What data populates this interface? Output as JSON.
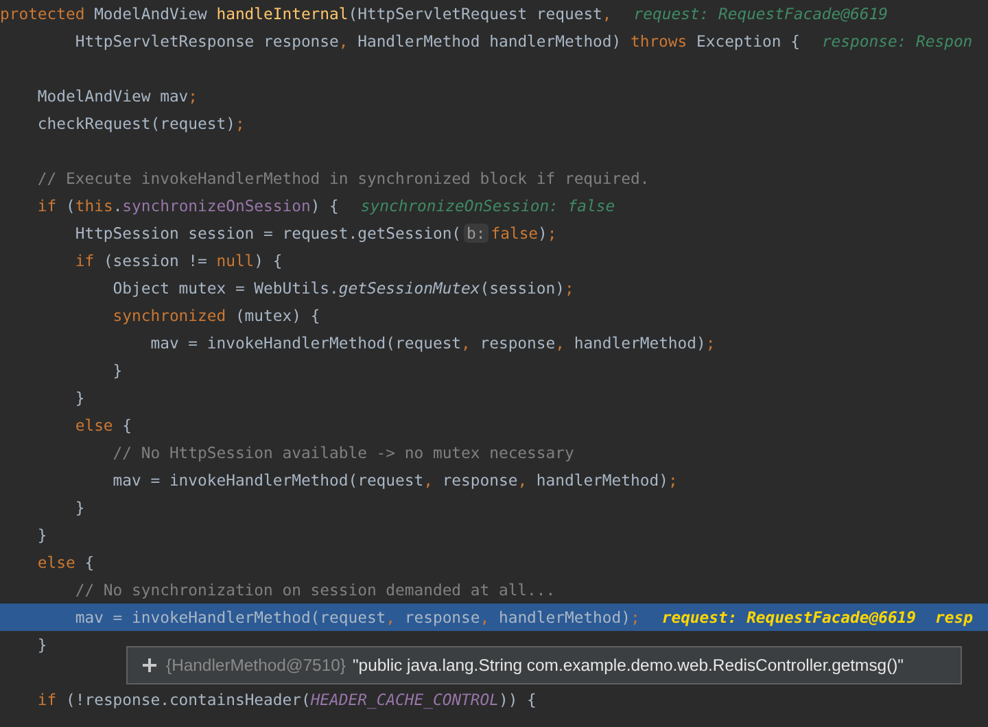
{
  "editor": {
    "lines": [
      {
        "selected": false,
        "code": [
          {
            "kind": "kw",
            "text": "protected "
          },
          {
            "kind": "plain",
            "text": "ModelAndView "
          },
          {
            "kind": "fn",
            "text": "handleInternal"
          },
          {
            "kind": "plain",
            "text": "(HttpServletRequest request"
          },
          {
            "kind": "punct",
            "text": ","
          }
        ],
        "hints": [
          "request: RequestFacade@6619"
        ]
      },
      {
        "selected": false,
        "code": [
          {
            "kind": "plain",
            "text": "        HttpServletResponse response"
          },
          {
            "kind": "punct",
            "text": ", "
          },
          {
            "kind": "plain",
            "text": "HandlerMethod handlerMethod) "
          },
          {
            "kind": "kw",
            "text": "throws "
          },
          {
            "kind": "plain",
            "text": "Exception {"
          }
        ],
        "hints": [
          "response: Respon"
        ]
      },
      {
        "selected": false
      },
      {
        "selected": false,
        "code": [
          {
            "kind": "plain",
            "text": "    ModelAndView mav"
          },
          {
            "kind": "punct",
            "text": ";"
          }
        ]
      },
      {
        "selected": false,
        "code": [
          {
            "kind": "plain",
            "text": "    checkRequest(request)"
          },
          {
            "kind": "punct",
            "text": ";"
          }
        ]
      },
      {
        "selected": false
      },
      {
        "selected": false,
        "code": [
          {
            "kind": "comment",
            "text": "    // Execute invokeHandlerMethod in synchronized block if required."
          }
        ]
      },
      {
        "selected": false,
        "code": [
          {
            "kind": "kw",
            "text": "    if "
          },
          {
            "kind": "plain",
            "text": "("
          },
          {
            "kind": "kw",
            "text": "this"
          },
          {
            "kind": "plain",
            "text": "."
          },
          {
            "kind": "field",
            "text": "synchronizeOnSession"
          },
          {
            "kind": "plain",
            "text": ") {"
          }
        ],
        "hints": [
          "synchronizeOnSession: false"
        ]
      },
      {
        "selected": false,
        "code": [
          {
            "kind": "plain",
            "text": "        HttpSession session = request.getSession("
          },
          {
            "kind": "param",
            "text": "b:"
          },
          {
            "kind": "kw",
            "text": "false"
          },
          {
            "kind": "plain",
            "text": ")"
          },
          {
            "kind": "punct",
            "text": ";"
          }
        ]
      },
      {
        "selected": false,
        "code": [
          {
            "kind": "kw",
            "text": "        if "
          },
          {
            "kind": "plain",
            "text": "(session != "
          },
          {
            "kind": "kw",
            "text": "null"
          },
          {
            "kind": "plain",
            "text": ") {"
          }
        ]
      },
      {
        "selected": false,
        "code": [
          {
            "kind": "plain",
            "text": "            Object mutex = WebUtils."
          },
          {
            "kind": "static",
            "text": "getSessionMutex"
          },
          {
            "kind": "plain",
            "text": "(session)"
          },
          {
            "kind": "punct",
            "text": ";"
          }
        ]
      },
      {
        "selected": false,
        "code": [
          {
            "kind": "kw",
            "text": "            synchronized "
          },
          {
            "kind": "plain",
            "text": "(mutex) {"
          }
        ]
      },
      {
        "selected": false,
        "code": [
          {
            "kind": "plain",
            "text": "                mav = invokeHandlerMethod(request"
          },
          {
            "kind": "punct",
            "text": ", "
          },
          {
            "kind": "plain",
            "text": "response"
          },
          {
            "kind": "punct",
            "text": ", "
          },
          {
            "kind": "plain",
            "text": "handlerMethod)"
          },
          {
            "kind": "punct",
            "text": ";"
          }
        ]
      },
      {
        "selected": false,
        "code": [
          {
            "kind": "plain",
            "text": "            }"
          }
        ]
      },
      {
        "selected": false,
        "code": [
          {
            "kind": "plain",
            "text": "        }"
          }
        ]
      },
      {
        "selected": false,
        "code": [
          {
            "kind": "kw",
            "text": "        else "
          },
          {
            "kind": "plain",
            "text": "{"
          }
        ]
      },
      {
        "selected": false,
        "code": [
          {
            "kind": "comment",
            "text": "            // No HttpSession available -> no mutex necessary"
          }
        ]
      },
      {
        "selected": false,
        "code": [
          {
            "kind": "plain",
            "text": "            mav = invokeHandlerMethod(request"
          },
          {
            "kind": "punct",
            "text": ", "
          },
          {
            "kind": "plain",
            "text": "response"
          },
          {
            "kind": "punct",
            "text": ", "
          },
          {
            "kind": "plain",
            "text": "handlerMethod)"
          },
          {
            "kind": "punct",
            "text": ";"
          }
        ]
      },
      {
        "selected": false,
        "code": [
          {
            "kind": "plain",
            "text": "        }"
          }
        ]
      },
      {
        "selected": false,
        "code": [
          {
            "kind": "plain",
            "text": "    }"
          }
        ]
      },
      {
        "selected": false,
        "code": [
          {
            "kind": "kw",
            "text": "    else "
          },
          {
            "kind": "plain",
            "text": "{"
          }
        ]
      },
      {
        "selected": false,
        "code": [
          {
            "kind": "comment",
            "text": "        // No synchronization on session demanded at all..."
          }
        ]
      },
      {
        "selected": true,
        "code": [
          {
            "kind": "plain",
            "text": "        mav = invokeHandlerMethod(request"
          },
          {
            "kind": "punct",
            "text": ", "
          },
          {
            "kind": "plain",
            "text": "response"
          },
          {
            "kind": "punct",
            "text": ", "
          },
          {
            "kind": "plain",
            "text": "handlerMethod)"
          },
          {
            "kind": "punct",
            "text": ";"
          }
        ],
        "hints": [
          "request: RequestFacade@6619",
          "resp"
        ]
      },
      {
        "selected": false,
        "code": [
          {
            "kind": "plain",
            "text": "    }"
          }
        ]
      },
      {
        "selected": false
      },
      {
        "selected": false,
        "code": [
          {
            "kind": "kw",
            "text": "    if "
          },
          {
            "kind": "plain",
            "text": "(!response.containsHeader("
          },
          {
            "kind": "const",
            "text": "HEADER_CACHE_CONTROL"
          },
          {
            "kind": "plain",
            "text": ")) {"
          }
        ]
      }
    ]
  },
  "tooltip": {
    "object_id": "{HandlerMethod@7510}",
    "value": "\"public java.lang.String com.example.demo.web.RedisController.getmsg()\""
  }
}
